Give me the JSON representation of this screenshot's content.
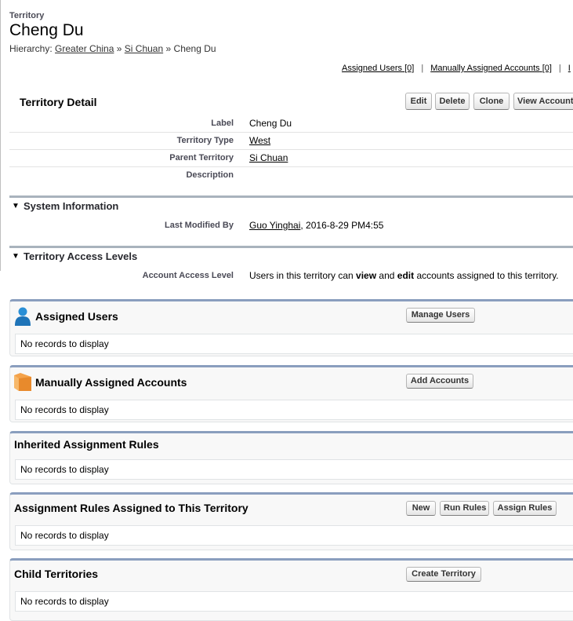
{
  "header": {
    "object_type": "Territory",
    "title": "Cheng Du",
    "hierarchy_label": "Hierarchy:",
    "hierarchy": [
      "Greater China",
      "Si Chuan",
      "Cheng Du"
    ],
    "hierarchy_sep": "»"
  },
  "related_links": [
    {
      "label": "Assigned Users",
      "count": "[0]"
    },
    {
      "label": "Manually Assigned Accounts",
      "count": "[0]"
    },
    {
      "label": "I",
      "count": ""
    }
  ],
  "detail": {
    "title": "Territory Detail",
    "buttons": {
      "edit": "Edit",
      "delete": "Delete",
      "clone": "Clone",
      "view_accounts": "View Accounts"
    },
    "fields": [
      {
        "label": "Label",
        "value": "Cheng Du",
        "link": false
      },
      {
        "label": "Territory Type",
        "value": "West",
        "link": true
      },
      {
        "label": "Parent Territory",
        "value": "Si Chuan",
        "link": true
      },
      {
        "label": "Description",
        "value": "",
        "link": false
      }
    ]
  },
  "system_info": {
    "title": "System Information",
    "label": "Last Modified By",
    "user": "Guo Yinghai",
    "date": ", 2016-8-29 PM4:55"
  },
  "access_levels": {
    "title": "Territory Access Levels",
    "label": "Account Access Level",
    "value_parts": [
      "Users in this territory can ",
      "view",
      " and ",
      "edit",
      " accounts assigned to this territory."
    ]
  },
  "related_lists": {
    "assigned_users": {
      "title": "Assigned Users",
      "button": "Manage Users",
      "empty": "No records to display"
    },
    "manual_accounts": {
      "title": "Manually Assigned Accounts",
      "button": "Add Accounts",
      "empty": "No records to display"
    },
    "inherited_rules": {
      "title": "Inherited Assignment Rules",
      "empty": "No records to display"
    },
    "assigned_rules": {
      "title": "Assignment Rules Assigned to This Territory",
      "buttons": {
        "new": "New",
        "run": "Run Rules",
        "assign": "Assign Rules"
      },
      "empty": "No records to display"
    },
    "child_territories": {
      "title": "Child Territories",
      "button": "Create Territory",
      "empty": "No records to display"
    }
  },
  "icons": {
    "assigned_users": "user-icon",
    "manual_accounts": "folder-icon",
    "collapse": "triangle-down-icon"
  },
  "colors": {
    "related_list_border": "#8a9ebe",
    "section_border": "#a9b3bd",
    "user_icon": "#2a8fd6",
    "folder_icon": "#f4a24a"
  }
}
